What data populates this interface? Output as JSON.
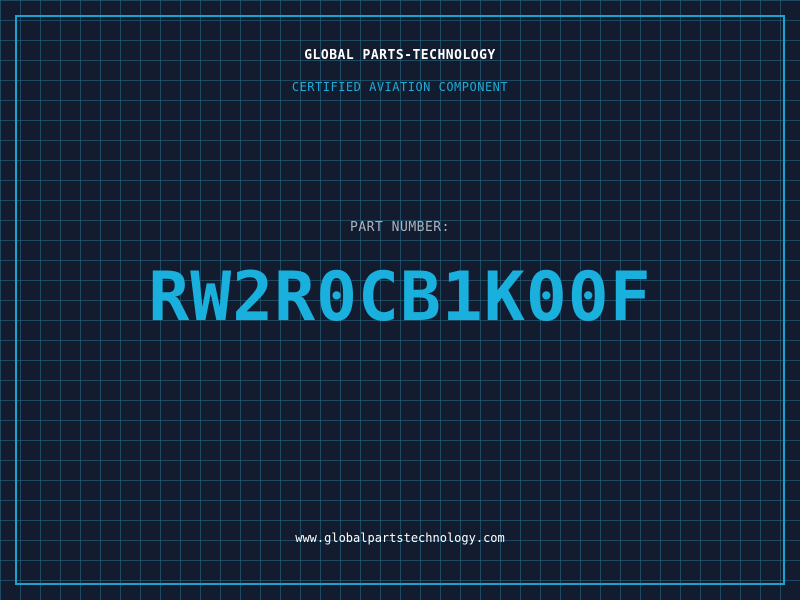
{
  "header": {
    "company": "GLOBAL PARTS-TECHNOLOGY",
    "subtitle": "CERTIFIED AVIATION COMPONENT"
  },
  "part": {
    "label": "PART NUMBER:",
    "number": "RW2R0CB1K00F"
  },
  "footer": {
    "website": "www.globalpartstechnology.com"
  },
  "colors": {
    "background": "#121c2e",
    "grid": "#286e8c",
    "accent": "#1aa3cc",
    "part_number": "#1ab0dd"
  }
}
